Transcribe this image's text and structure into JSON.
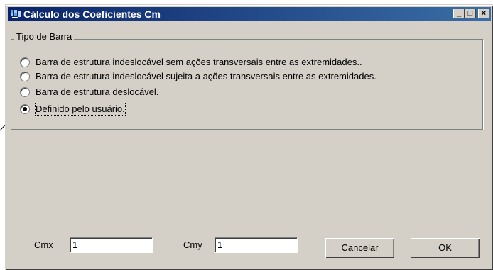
{
  "window": {
    "title": "Cálculo dos Coeficientes Cm",
    "minimize_glyph": "_",
    "maximize_glyph": "□",
    "close_glyph": "×"
  },
  "group": {
    "label": "Tipo de Barra",
    "options": [
      {
        "label": "Barra de estrutura indeslocável sem ações transversais entre as extremidades..",
        "selected": false
      },
      {
        "label": "Barra de estrutura indeslocável sujeita a ações transversais entre as extremidades.",
        "selected": false
      },
      {
        "label": "Barra de estrutura deslocável.",
        "selected": false
      },
      {
        "label": "Definido pelo usuário.",
        "selected": true
      }
    ]
  },
  "fields": {
    "cmx_label": "Cmx",
    "cmx_value": "1",
    "cmy_label": "Cmy",
    "cmy_value": "1"
  },
  "buttons": {
    "cancel": "Cancelar",
    "ok": "OK"
  },
  "colors": {
    "titlebar_start": "#0a246a",
    "titlebar_end": "#3a6ea5",
    "face": "#d4d0c8"
  }
}
